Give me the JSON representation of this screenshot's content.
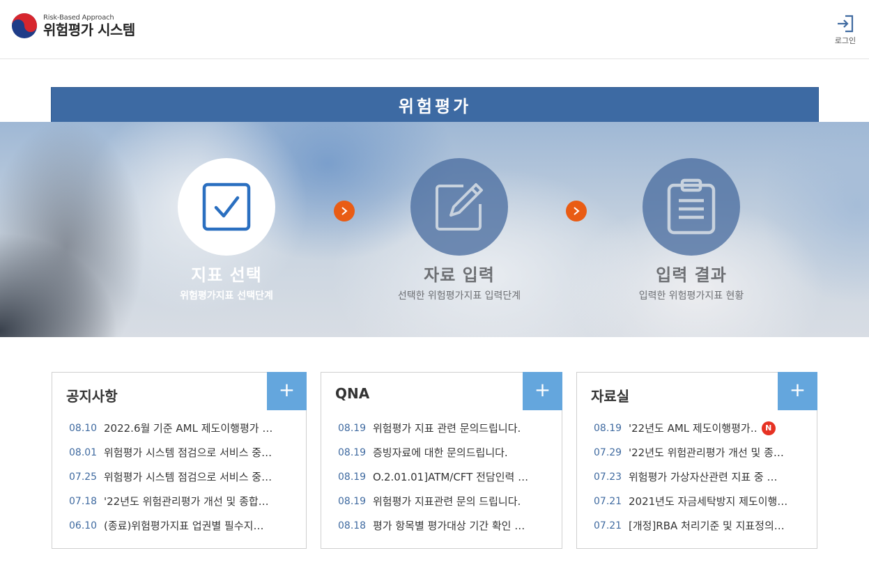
{
  "header": {
    "logo_subtitle": "Risk-Based Approach",
    "logo_title": "위험평가 시스템",
    "login_label": "로그인"
  },
  "hero": {
    "title": "위험평가",
    "steps": [
      {
        "title": "지표 선택",
        "desc": "위험평가지표 선택단계",
        "icon": "checkbox-icon",
        "state": "active"
      },
      {
        "title": "자료 입력",
        "desc": "선택한 위험평가지표 입력단계",
        "icon": "edit-icon",
        "state": "inactive"
      },
      {
        "title": "입력 결과",
        "desc": "입력한 위험평가지표 현황",
        "icon": "clipboard-icon",
        "state": "inactive"
      }
    ],
    "accent_color": "#e95c14",
    "tab_color": "#3d6aa3"
  },
  "panels": [
    {
      "title": "공지사항",
      "more_label": "+",
      "items": [
        {
          "date": "08.10",
          "text": "2022.6월 기준 AML 제도이행평가 …"
        },
        {
          "date": "08.01",
          "text": "위험평가 시스템 점검으로 서비스 중…"
        },
        {
          "date": "07.25",
          "text": "위험평가 시스템 점검으로 서비스 중…"
        },
        {
          "date": "07.18",
          "text": "'22년도 위험관리평가 개선 및 종합…"
        },
        {
          "date": "06.10",
          "text": "(종료)위험평가지표 업권별 필수지…"
        }
      ]
    },
    {
      "title": "QNA",
      "more_label": "+",
      "items": [
        {
          "date": "08.19",
          "text": "위험평가 지표 관련 문의드립니다."
        },
        {
          "date": "08.19",
          "text": "증빙자료에 대한 문의드립니다."
        },
        {
          "date": "08.19",
          "text": "O.2.01.01]ATM/CFT 전담인력 …"
        },
        {
          "date": "08.19",
          "text": "위험평가 지표관련 문의 드립니다."
        },
        {
          "date": "08.18",
          "text": "평가 항목별 평가대상 기간 확인 …"
        }
      ]
    },
    {
      "title": "자료실",
      "more_label": "+",
      "items": [
        {
          "date": "08.19",
          "text": "'22년도 AML 제도이행평가‥",
          "badge": "N"
        },
        {
          "date": "07.29",
          "text": "'22년도 위험관리평가 개선 및 종…"
        },
        {
          "date": "07.23",
          "text": "위험평가 가상자산관련 지표 중 …"
        },
        {
          "date": "07.21",
          "text": "2021년도 자금세탁방지 제도이행…"
        },
        {
          "date": "07.21",
          "text": "[개정]RBA 처리기준 및 지표정의…"
        }
      ]
    }
  ]
}
